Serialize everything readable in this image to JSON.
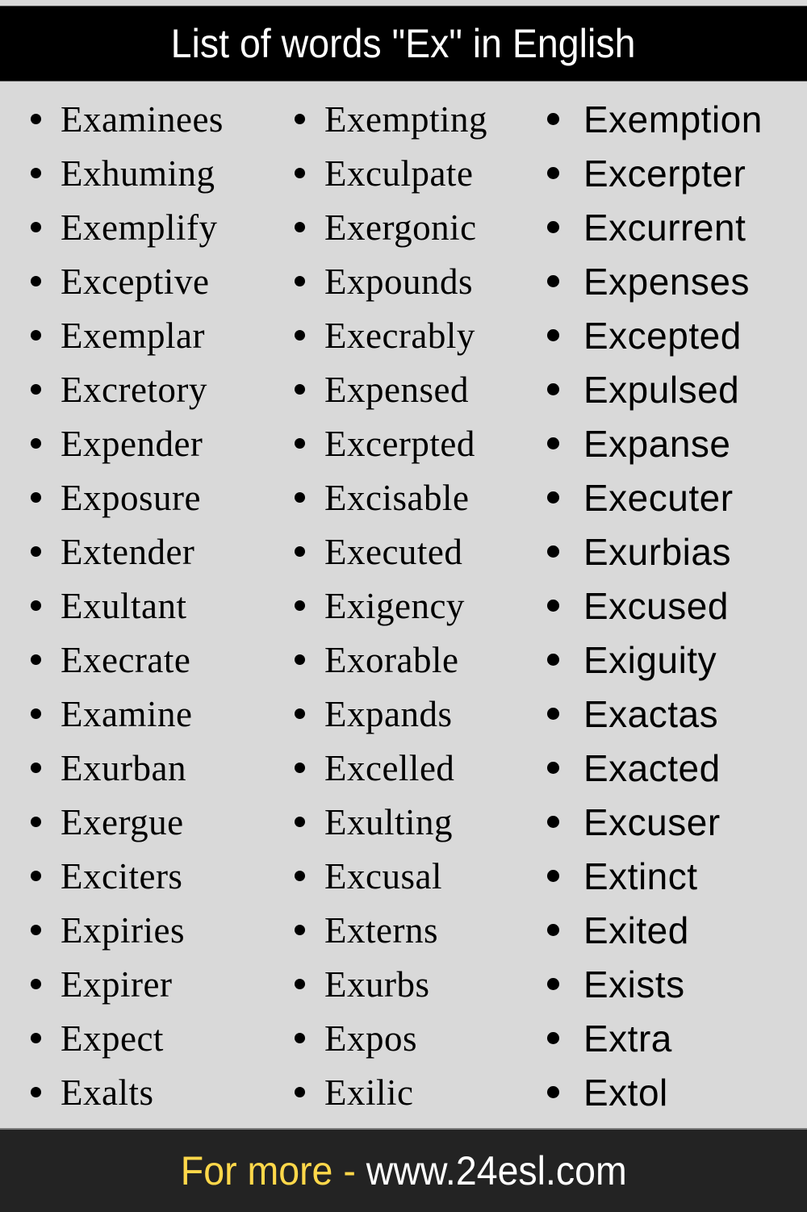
{
  "header": {
    "title": "List of words \"Ex\" in English"
  },
  "columns": [
    {
      "words": [
        "Examinees",
        "Exhuming",
        "Exemplify",
        "Exceptive",
        "Exemplar",
        "Excretory",
        "Expender",
        "Exposure",
        "Extender",
        "Exultant",
        "Execrate",
        "Examine",
        "Exurban",
        "Exergue",
        "Exciters",
        "Expiries",
        "Expirer",
        "Expect",
        "Exalts"
      ]
    },
    {
      "words": [
        "Exempting",
        "Exculpate",
        "Exergonic",
        "Expounds",
        "Execrably",
        "Expensed",
        "Excerpted",
        "Excisable",
        "Executed",
        "Exigency",
        "Exorable",
        "Expands",
        "Excelled",
        "Exulting",
        "Excusal",
        "Externs",
        "Exurbs",
        "Expos",
        "Exilic"
      ]
    },
    {
      "words": [
        "Exemption",
        "Excerpter",
        "Excurrent",
        "Expenses",
        "Excepted",
        "Expulsed",
        "Expanse",
        "Executer",
        "Exurbias",
        "Excused",
        "Exiguity",
        "Exactas",
        "Exacted",
        "Excuser",
        "Extinct",
        "Exited",
        "Exists",
        "Extra",
        "Extol"
      ]
    }
  ],
  "footer": {
    "prefix": "For more - ",
    "url": "www.24esl.com"
  },
  "colors": {
    "background": "#d9d9d9",
    "header_bg": "#000000",
    "footer_bg": "#232323",
    "footer_prefix": "#ffd84a",
    "footer_url": "#ffffff"
  }
}
